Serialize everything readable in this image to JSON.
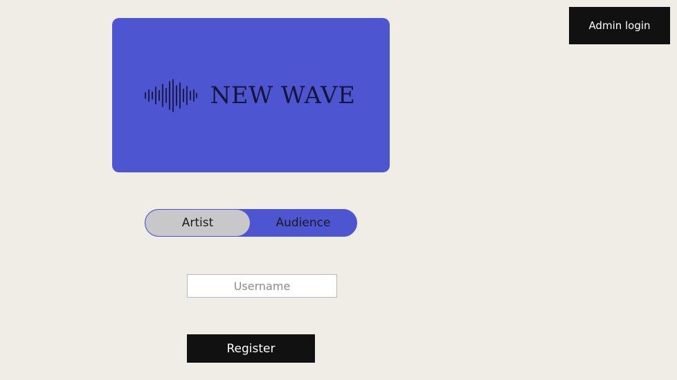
{
  "header": {
    "admin_login_label": "Admin login"
  },
  "logo": {
    "brand_name": "NEW WAVE",
    "icon": "sound-wave-icon",
    "background_color": "#4d55d0"
  },
  "role_toggle": {
    "options": [
      {
        "label": "Artist",
        "selected": true
      },
      {
        "label": "Audience",
        "selected": false
      }
    ]
  },
  "form": {
    "username_placeholder": "Username",
    "username_value": "",
    "register_label": "Register"
  },
  "colors": {
    "background": "#efede6",
    "accent": "#4d55d0",
    "button": "#111111",
    "toggle_selected": "#c8c7ca"
  }
}
